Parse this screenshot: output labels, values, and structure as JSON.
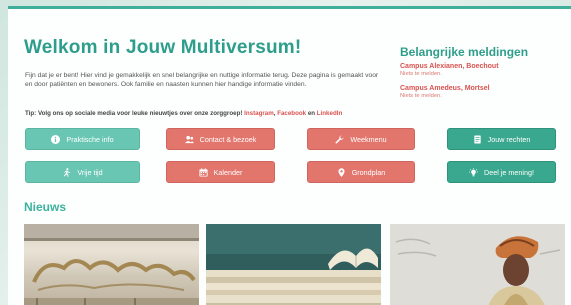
{
  "header": {
    "title": "Welkom in Jouw Multiversum!",
    "intro": "Fijn dat je er bent! Hier vind je gemakkelijk en snel belangrijke en nuttige informatie terug. Deze pagina is gemaakt voor en door patiënten en bewoners. Ook familie en naasten kunnen hier handige informatie vinden.",
    "tip_prefix": "Tip: Volg ons op sociale media voor leuke nieuwtjes over onze zorggroep!",
    "tip_instagram": "Instagram",
    "tip_sep": ",",
    "tip_facebook": "Facebook",
    "tip_and": "en",
    "tip_linkedin": "LinkedIn"
  },
  "notices": {
    "heading": "Belangrijke meldingen",
    "items": [
      {
        "title": "Campus Alexianen, Boechout",
        "text": "Niets te melden."
      },
      {
        "title": "Campus Amedeus, Mortsel",
        "text": "Niets te melden."
      }
    ]
  },
  "buttons": {
    "praktische_info": "Praktische info",
    "contact": "Contact & bezoek",
    "weekmenu": "Weekmenu",
    "jouw_rechten": "Jouw rechten",
    "vrije_tijd": "Vrije tijd",
    "kalender": "Kalender",
    "grondplan": "Grondplan",
    "deel_mening": "Deel je mening!"
  },
  "news": {
    "heading": "Nieuws"
  },
  "colors": {
    "brand_teal": "#2e9e8c",
    "button_teal": "#69c6b3",
    "button_coral": "#e2766d",
    "button_green": "#3aa88f",
    "alert_red": "#d9534f"
  },
  "icons": {
    "praktische_info": "info-circle-icon",
    "contact": "users-icon",
    "weekmenu": "wrench-icon",
    "jouw_rechten": "document-icon",
    "vrije_tijd": "running-icon",
    "kalender": "calendar-icon",
    "grondplan": "map-pin-icon",
    "deel_mening": "lightbulb-icon"
  }
}
